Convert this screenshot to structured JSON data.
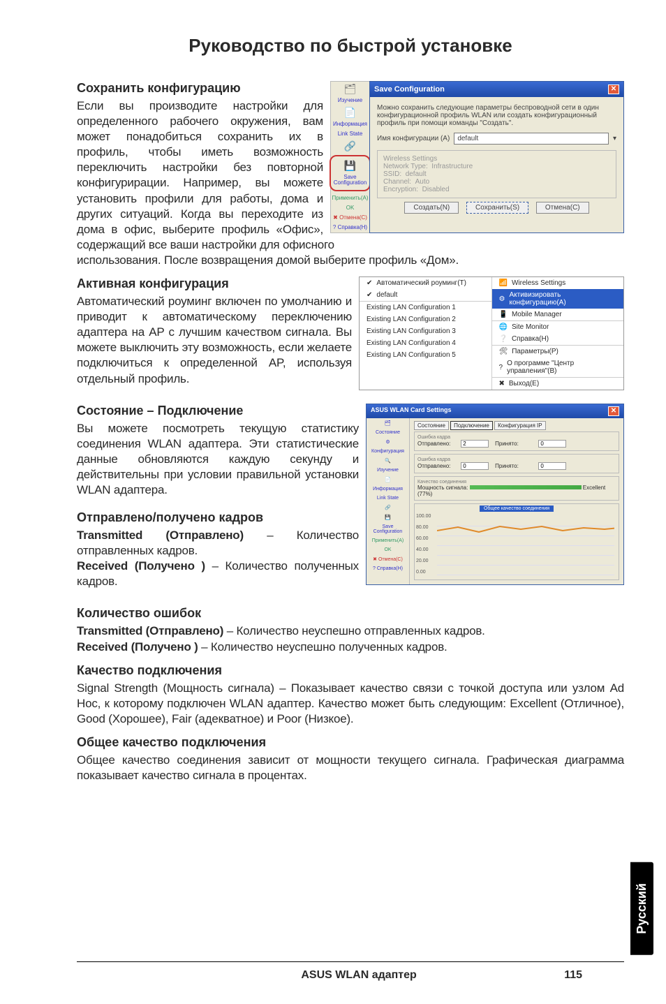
{
  "page_title": "Руководство по быстрой установке",
  "save_config": {
    "heading": "Сохранить конфигурацию",
    "body1": "Если вы производите настройки для определенного рабочего окружения, вам может понадобиться сохранить их в профиль, чтобы иметь возможность переключить настройки без повторной конфигурирации.  Например, вы можете установить профили для работы, дома и других ситуаций.  Когда вы переходите из дома в офис, выберите профиль «Офис», содержащий все ваши настройки для офисного",
    "body2": "использования. После возвращения домой выберите профиль «Дом».",
    "dialog": {
      "title": "Save Configuration",
      "desc": "Можно сохранить следующие параметры беспроводной сети в один конфигурационной профиль WLAN или создать конфигурационный профиль при помощи команды \"Создать\".",
      "label_name": "Имя конфигурации (A)",
      "value_name": "default",
      "fieldset_title": "Wireless Settings",
      "rows": {
        "network_type_lbl": "Network Type:",
        "network_type_val": "Infrastructure",
        "ssid_lbl": "SSID:",
        "ssid_val": "default",
        "channel_lbl": "Channel:",
        "channel_val": "Auto",
        "encryption_lbl": "Encryption:",
        "encryption_val": "Disabled"
      },
      "buttons": {
        "create": "Создать(N)",
        "save": "Сохранить(S)",
        "cancel": "Отмена(C)"
      }
    },
    "side": {
      "i0": "Изучение",
      "i1": "Информация",
      "i2": "Link State",
      "i3": "Save Configuration",
      "i4": "Применить(A)",
      "i5": "OK",
      "i6": "Отмена(C)",
      "i7": "Справка(H)"
    }
  },
  "active_config": {
    "heading": "Активная конфигурация",
    "body": "Автоматический роуминг включен по умолчанию и приводит к автоматическому переключению адаптера на AP с лучшим качеством сигнала. Вы можете выключить эту возможность, если желаете подключиться к определенной AP, используя отдельный профиль.",
    "menu_left": {
      "t0": "Автоматический роуминг(T)",
      "t1": "default",
      "t2": "Existing LAN Configuration 1",
      "t3": "Existing LAN Configuration 2",
      "t4": "Existing LAN Configuration 3",
      "t5": "Existing LAN Configuration 4",
      "t6": "Existing LAN Configuration 5"
    },
    "menu_right": {
      "r0": "Wireless Settings",
      "r1": "Активизировать конфигурацию(A)",
      "r2": "Mobile Manager",
      "r3": "Site Monitor",
      "r4": "Справка(H)",
      "r5": "Параметры(P)",
      "r6": "О программе \"Центр управления\"(B)",
      "r7": "Выход(E)"
    }
  },
  "status": {
    "heading": "Состояние – Подключение",
    "body": "Вы можете посмотреть текущую статистику соединения WLAN адаптера. Эти статистические данные обновляются каждую секунду и действительны при условии правильной установки  WLAN адаптера."
  },
  "frames": {
    "heading": "Отправлено/получено кадров",
    "tx_b": "Transmitted (Отправлено)",
    "tx_t": " – Количество отправленных кадров.",
    "rx_b": "Received (Получено )",
    "rx_t": " – Количество полученных кадров."
  },
  "errors": {
    "heading": "Количество ошибок",
    "tx_b": "Transmitted (Отправлено)",
    "tx_t": " – Количество неуспешно отправленных кадров.",
    "rx_b": "Received (Получено )",
    "rx_t": " – Количество неуспешно полученных кадров."
  },
  "quality": {
    "heading": "Качество подключения",
    "body": "Signal Strength (Мощность сигнала) – Показывает качество связи с точкой доступа или узлом Ad Hoc, к которому подключен WLAN адаптер. Качество может быть следующим: Excellent (Отличное), Good (Хорошее), Fair (адекватное) и Poor (Низкое)."
  },
  "overall": {
    "heading": "Общее качество подключения",
    "body": "Общее качество соединения зависит от мощности текущего сигнала. Графическая диаграмма показывает качество сигнала в процентах."
  },
  "link_status": {
    "title": "ASUS WLAN Card Settings",
    "tabs": {
      "t0": "Состояние",
      "t1": "Подключение",
      "t2": "Конфигурация IP"
    },
    "frame_err": "Ошибка кадра",
    "sent": "Отправлено:",
    "recv": "Принято:",
    "sent_val": "2",
    "recv_val": "0",
    "sent2_val": "0",
    "recv2_val": "0",
    "conn_q": "Качество соединения",
    "sig": "Мощность сигнала:",
    "sig_val": "Excellent (77%)",
    "graph_title": "Общее качество соединения",
    "y100": "100.00",
    "y80": "80.00",
    "y60": "60.00",
    "y40": "40.00",
    "y20": "20.00",
    "y0": "0.00",
    "side": {
      "s0": "Состояние",
      "s1": "Конфигурация",
      "s2": "Изучение",
      "s3": "Информация",
      "s4": "Link State",
      "s5": "Save Configuration",
      "s6": "Применить(A)",
      "s7": "OK",
      "s8": "Отмена(C)",
      "s9": "Справка(H)"
    }
  },
  "footer": {
    "center": "ASUS WLAN адаптер",
    "page": "115"
  },
  "lang_tab": "Русский"
}
